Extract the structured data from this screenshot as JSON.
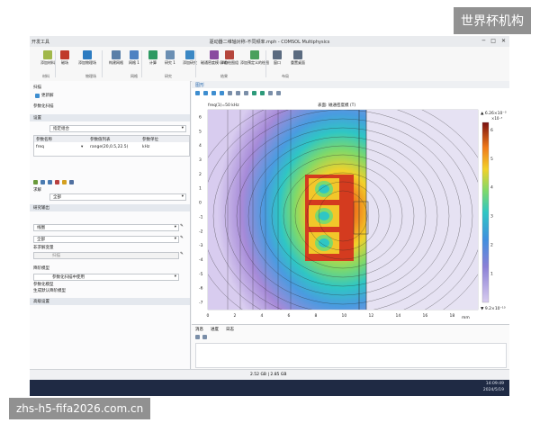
{
  "watermark_top": "世界杯机构",
  "watermark_bottom": "zhs-h5-fifa2026.com.cn",
  "window": {
    "title": "驱动器二维轴对称-不同频率.mph - COMSOL Multiphysics",
    "left_label": "开发工具"
  },
  "ribbon": {
    "items": [
      {
        "label": "添加材料",
        "color": "#a1b84a"
      },
      {
        "label": "磁场",
        "color": "#c0392b"
      },
      {
        "label": "添加物理场",
        "color": "#2d7cc1"
      },
      {
        "label": "构建网格",
        "color": "#5a7fa8"
      },
      {
        "label": "网格 1",
        "color": "#4f82c2"
      },
      {
        "label": "计算",
        "color": "#2e9a63"
      },
      {
        "label": "研究 1",
        "color": "#6b8fb3"
      },
      {
        "label": "添加研究",
        "color": "#3b88c4"
      },
      {
        "label": "磁通密度模 (mf)",
        "color": "#8a4aa0"
      },
      {
        "label": "添加绘图组",
        "color": "#b5463c"
      },
      {
        "label": "添加预定义的绘图",
        "color": "#4aa05c"
      },
      {
        "label": "窗口",
        "color": "#5b6b80"
      },
      {
        "label": "重置桌面",
        "color": "#5b6b80"
      }
    ],
    "groups": [
      "材料",
      "物理场",
      "网格",
      "研究",
      "结果",
      "布局"
    ]
  },
  "left_panel": {
    "header": "扫描",
    "update_label": "更新解",
    "name_label": "参数化扫描",
    "section_settings": "设置",
    "sweep_type": "指定组合",
    "table_headers": [
      "参数名称",
      "参数值列表",
      "参数单位"
    ],
    "table_row": [
      "freq",
      "range(20,0.5,22.5)",
      "kHz"
    ],
    "section_output": "求解",
    "dropdown_all": "全部",
    "section_study_output": "研究输出",
    "dropdown_coil": "线圈",
    "dropdown_all2": "全部",
    "label_nonactive": "非求解变量",
    "label_sweep": "扫描",
    "section_reduced": "降阶模型",
    "reduced_label": "参数化扫描中使用",
    "model_label": "参数化模型",
    "param_label": "生成默认降阶模型",
    "section_advanced": "高级设置"
  },
  "graphics": {
    "panel_title": "图形",
    "plot_title_left": "freq(1)=50 kHz",
    "plot_title_right": "表面: 磁通密度模 (T)",
    "x_ticks": [
      "0",
      "2",
      "4",
      "6",
      "8",
      "10",
      "12",
      "14",
      "16",
      "18"
    ],
    "x_unit": "mm",
    "y_ticks": [
      "6",
      "5",
      "4",
      "3",
      "2",
      "1",
      "0",
      "-1",
      "-2",
      "-3",
      "-4",
      "-5",
      "-6",
      "-7"
    ],
    "colorbar_max": "▲ 6.26×10⁻³",
    "colorbar_max_exp": "×10⁻³",
    "colorbar_ticks": [
      "6",
      "5",
      "4",
      "3",
      "2",
      "1"
    ],
    "colorbar_min": "▼ 9.2×10⁻¹⁰"
  },
  "messages": {
    "tabs": [
      "消息",
      "进度",
      "日志"
    ]
  },
  "status": {
    "memory": "2.52 GB | 2.85 GB"
  },
  "taskbar": {
    "time": "14:09:49",
    "date": "2024/5/19"
  }
}
